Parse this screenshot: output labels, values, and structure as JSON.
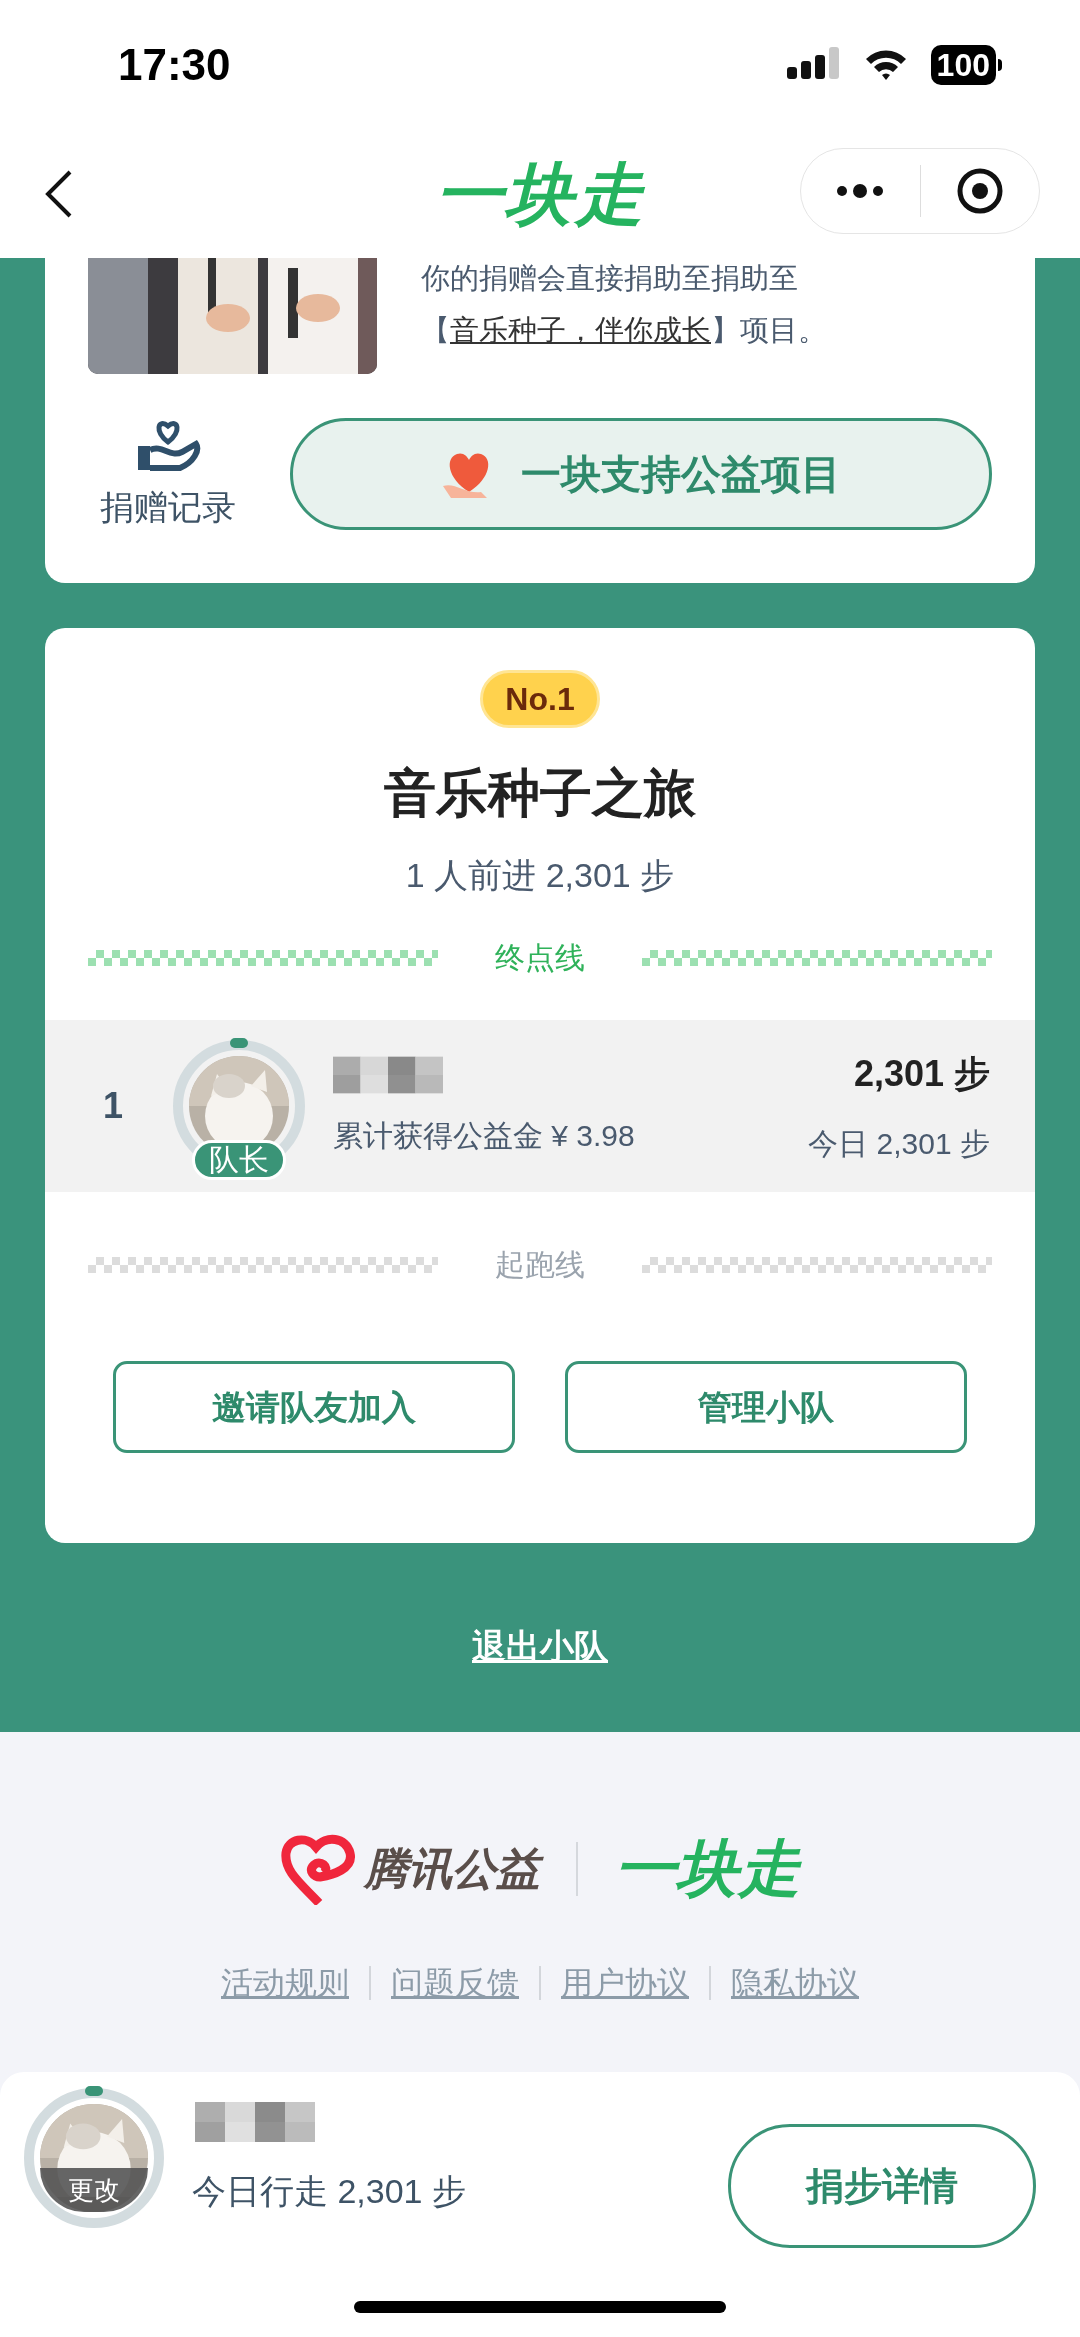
{
  "status_bar": {
    "time": "17:30",
    "battery": "100"
  },
  "nav": {
    "title": "一块走"
  },
  "project_card": {
    "description_before": "你的捐赠会直接捐助至捐助至【",
    "link": "音乐种子，伴你成长",
    "description_after": "】项目。",
    "records_label": "捐赠记录",
    "support_button": "一块支持公益项目"
  },
  "team_card": {
    "rank_badge": "No.1",
    "name": "音乐种子之旅",
    "summary": "1 人前进 2,301 步",
    "finish_label": "终点线",
    "start_label": "起跑线",
    "members": [
      {
        "rank": "1",
        "role": "队长",
        "earned": "累计获得公益金 ¥ 3.98",
        "total_steps": "2,301 步",
        "today_steps": "今日 2,301 步"
      }
    ],
    "buttons": [
      "邀请队友加入",
      "管理小队"
    ]
  },
  "exit_link": "退出小队",
  "footer": {
    "brand": "腾讯公益",
    "app": "一块走",
    "links": [
      "活动规则",
      "问题反馈",
      "用户协议",
      "隐私协议"
    ]
  },
  "bottom_bar": {
    "avatar_action": "更改",
    "today": "今日行走 2,301 步",
    "button": "捐步详情"
  }
}
